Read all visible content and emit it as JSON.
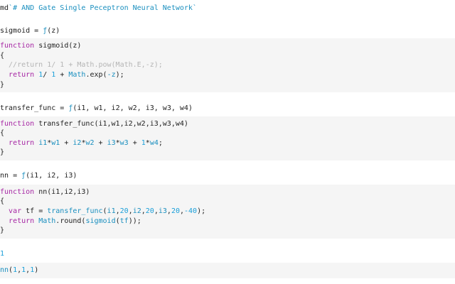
{
  "cells": {
    "md_header": {
      "prefix": "md",
      "text": "`# AND Gate Single Peceptron Neural Network`"
    },
    "sigmoid_output": {
      "name": "sigmoid",
      "eq": " = ",
      "f": "ƒ",
      "args": "(z)"
    },
    "sigmoid_input": {
      "l1_kw": "function",
      "l1_rest": " sigmoid(z)",
      "l2": "{",
      "l3_comment": "  //return 1/ 1 + Math.pow(Math.E,-z);",
      "l4_indent": "  ",
      "l4_kw": "return",
      "l4_sp": " ",
      "l4_n1": "1",
      "l4_div": "/ ",
      "l4_n2": "1",
      "l4_plus": " + ",
      "l4_math": "Math",
      "l4_exp": ".exp(",
      "l4_z": "-z",
      "l4_end": ");",
      "l5": "}"
    },
    "transfer_output": {
      "name": "transfer_func",
      "eq": " = ",
      "f": "ƒ",
      "args": "(i1, w1, i2, w2, i3, w3, w4)"
    },
    "transfer_input": {
      "l1_kw": "function",
      "l1_rest": " transfer_func(i1,w1,i2,w2,i3,w3,w4)",
      "l2": "{",
      "l3_indent": "  ",
      "l3_kw": "return",
      "l3_sp": " ",
      "l3_a": "i1",
      "l3_m1": "*",
      "l3_b": "w1",
      "l3_p1": " + ",
      "l3_c": "i2",
      "l3_m2": "*",
      "l3_d": "w2",
      "l3_p2": " + ",
      "l3_e": "i3",
      "l3_m3": "*",
      "l3_f": "w3",
      "l3_p3": " + ",
      "l3_g": "1",
      "l3_m4": "*",
      "l3_h": "w4",
      "l3_end": ";",
      "l4": "}"
    },
    "nn_output": {
      "name": "nn",
      "eq": " = ",
      "f": "ƒ",
      "args": "(i1, i2, i3)"
    },
    "nn_input": {
      "l1_kw": "function",
      "l1_rest": " nn(i1,i2,i3)",
      "l2": "{",
      "l3_indent": "  ",
      "l3_kw": "var",
      "l3_rest": " tf = ",
      "l3_fn": "transfer_func",
      "l3_open": "(",
      "l3_a1": "i1",
      "l3_cm1": ",",
      "l3_n1": "20",
      "l3_cm2": ",",
      "l3_a2": "i2",
      "l3_cm3": ",",
      "l3_n2": "20",
      "l3_cm4": ",",
      "l3_a3": "i3",
      "l3_cm5": ",",
      "l3_n3": "20",
      "l3_cm6": ",",
      "l3_n4": "-40",
      "l3_end": ");",
      "l4_indent": "  ",
      "l4_kw": "return",
      "l4_sp": " ",
      "l4_math": "Math",
      "l4_round": ".round(",
      "l4_fn": "sigmoid",
      "l4_open": "(",
      "l4_tf": "tf",
      "l4_end": "));",
      "l5": "}"
    },
    "result_output": {
      "value": "1"
    },
    "call_input": {
      "fn": "nn",
      "open": "(",
      "a": "1",
      "c1": ",",
      "b": "1",
      "c2": ",",
      "c": "1",
      "close": ")"
    }
  },
  "colors": {
    "keyword": "#a626a4",
    "number": "#1a9fd9",
    "comment": "#b5b5b5",
    "cell_background": "#f5f5f5"
  }
}
